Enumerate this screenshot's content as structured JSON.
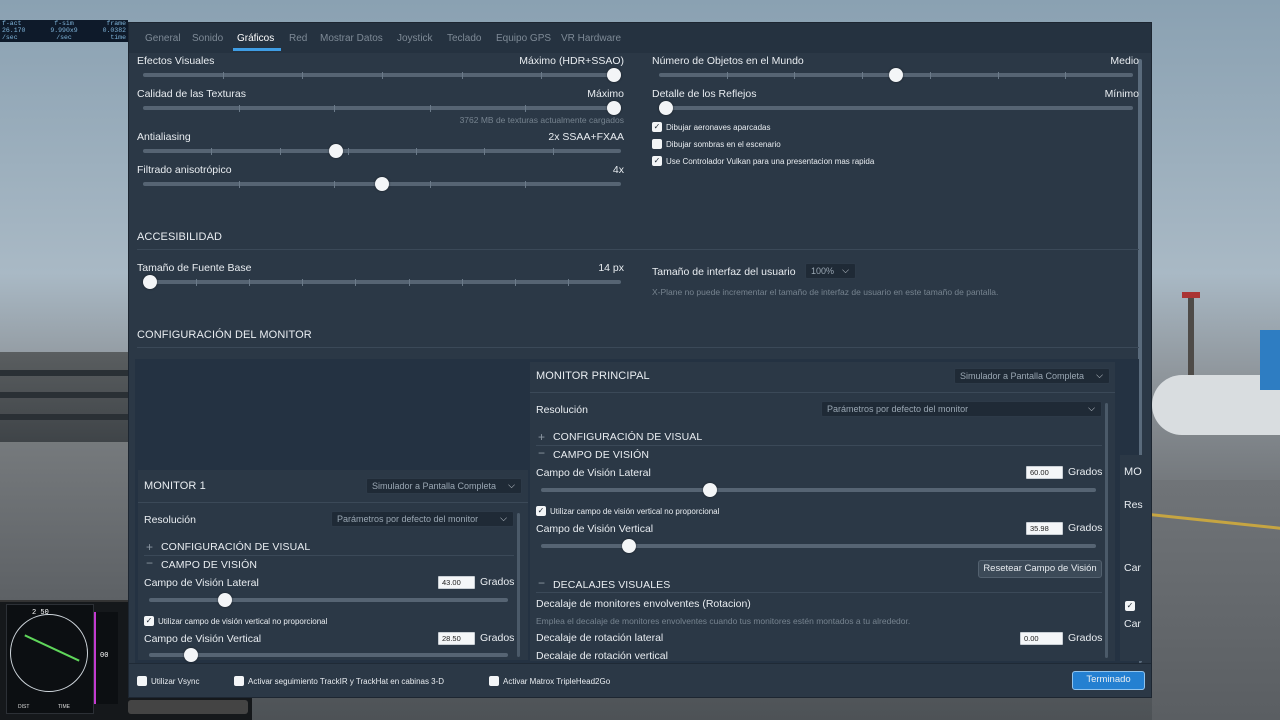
{
  "readout": {
    "labels": [
      "f-act",
      "f-sim",
      "frame"
    ],
    "values": [
      "26.170",
      "9.990x9",
      "0.0382"
    ],
    "units": [
      "/sec",
      "/sec",
      "time"
    ]
  },
  "instrument": {
    "heading": "2 50",
    "alt": "00",
    "dist_label": "DIST",
    "time_label": "TIME"
  },
  "tabs": [
    "General",
    "Sonido",
    "Gráficos",
    "Red",
    "Mostrar Datos",
    "Joystick",
    "Teclado",
    "Equipo GPS",
    "VR Hardware"
  ],
  "active_tab": "Gráficos",
  "graphics": {
    "visual_effects": {
      "label": "Efectos Visuales",
      "value": "Máximo (HDR+SSAO)",
      "level": 1.0
    },
    "texture_quality": {
      "label": "Calidad de las Texturas",
      "value": "Máximo",
      "level": 1.0,
      "note": "3762 MB de texturas actualmente cargados"
    },
    "antialiasing": {
      "label": "Antialiasing",
      "value": "2x SSAA+FXAA",
      "level": 0.4
    },
    "anisotropic": {
      "label": "Filtrado anisotrópico",
      "value": "4x",
      "level": 0.5
    },
    "world_objects": {
      "label": "Número de Objetos en el Mundo",
      "value": "Medio",
      "level": 0.5
    },
    "reflections": {
      "label": "Detalle de los Reflejos",
      "value": "Mínimo",
      "level": 0.0
    },
    "checkboxes": [
      {
        "label": "Dibujar aeronaves aparcadas",
        "checked": true
      },
      {
        "label": "Dibujar sombras en el escenario",
        "checked": false
      },
      {
        "label": "Use Controlador Vulkan para una presentacion mas rapida",
        "checked": true
      }
    ]
  },
  "accessibility": {
    "heading": "ACCESIBILIDAD",
    "font_size": {
      "label": "Tamaño de Fuente Base",
      "value": "14 px",
      "level": 0.0
    },
    "ui_size": {
      "label": "Tamaño de interfaz del usuario",
      "value": "100%",
      "note": "X-Plane no puede incrementar el tamaño de interfaz de usuario en este tamaño de pantalla."
    }
  },
  "monitor_config": {
    "heading": "CONFIGURACIÓN DEL MONITOR",
    "monitor1": {
      "title": "MONITOR 1",
      "mode": "Simulador a Pantalla Completa",
      "resolution_label": "Resolución",
      "resolution": "Parámetros por defecto del monitor",
      "visual_config": "CONFIGURACIÓN DE VISUAL",
      "fov_heading": "CAMPO DE VISIÓN",
      "lateral_label": "Campo de Visión Lateral",
      "lateral_value": "43.00",
      "lateral_level": 0.2,
      "units": "Grados",
      "nonprop_label": "Utilizar campo de visión vertical no proporcional",
      "vertical_label": "Campo de Visión Vertical",
      "vertical_value": "28.50",
      "vertical_level": 0.1
    },
    "main": {
      "title": "MONITOR PRINCIPAL",
      "mode": "Simulador a Pantalla Completa",
      "resolution_label": "Resolución",
      "resolution": "Parámetros por defecto del monitor",
      "visual_config": "CONFIGURACIÓN DE VISUAL",
      "fov_heading": "CAMPO DE VISIÓN",
      "lateral_label": "Campo de Visión Lateral",
      "lateral_value": "60.00",
      "lateral_level": 0.3,
      "units": "Grados",
      "nonprop_label": "Utilizar campo de visión vertical no proporcional",
      "vertical_label": "Campo de Visión Vertical",
      "vertical_value": "35.98",
      "vertical_level": 0.15,
      "reset_button": "Resetear Campo de Visión",
      "offsets_heading": "DECALAJES VISUALES",
      "wrap_title": "Decalaje de monitores envolventes (Rotacion)",
      "wrap_note": "Emplea el decalaje de monitores envolventes cuando tus monitores estén montados a tu alrededor.",
      "lateral_rot_label": "Decalaje de rotación lateral",
      "lateral_rot_value": "0.00",
      "vertical_rot_label": "Decalaje de rotación vertical"
    },
    "right_fragments": {
      "title": "MO",
      "res": "Res",
      "a": "Car",
      "b": "Car"
    }
  },
  "footer": {
    "vsync": "Utilizar Vsync",
    "trackir": "Activar seguimiento TrackIR y TrackHat en cabinas 3-D",
    "matrox": "Activar Matrox TripleHead2Go",
    "done": "Terminado"
  },
  "colors": {
    "accent": "#3f9de4",
    "dialog_bg": "#2b3846",
    "primary_button": "#2480d1"
  }
}
